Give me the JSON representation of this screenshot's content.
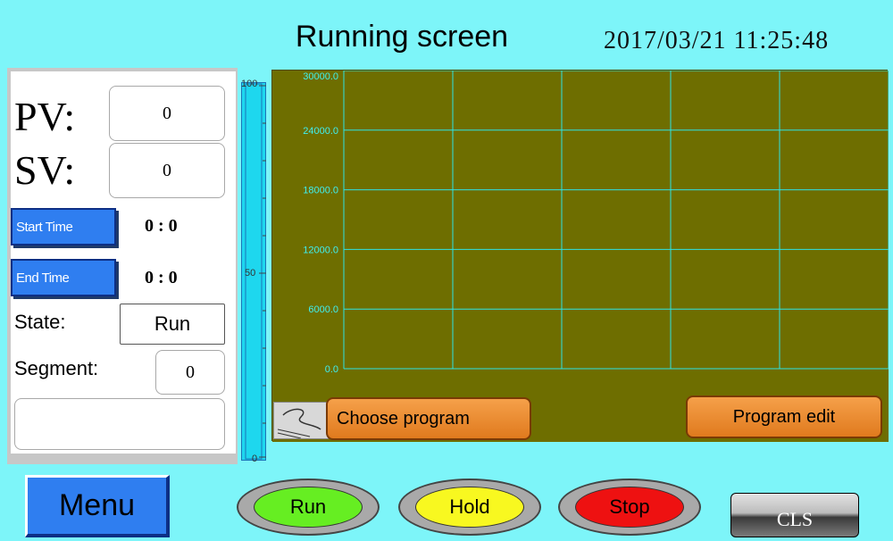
{
  "header": {
    "title": "Running screen",
    "datetime": "2017/03/21 11:25:48"
  },
  "left": {
    "pv_label": "PV:",
    "pv_value": "0",
    "sv_label": "SV:",
    "sv_value": "0",
    "start_time_label": "Start Time",
    "start_time_value": "0 : 0",
    "end_time_label": "End Time",
    "end_time_value": "0 : 0",
    "state_label": "State:",
    "state_value": "Run",
    "segment_label": "Segment:",
    "segment_value": "0",
    "message_value": ""
  },
  "gauge": {
    "ticks": [
      "100",
      "50",
      "0"
    ],
    "level": 0
  },
  "chart_data": {
    "type": "line",
    "y_ticks": [
      "30000.0",
      "24000.0",
      "18000.0",
      "12000.0",
      "6000.0",
      "0.0"
    ],
    "ylim": [
      0,
      30000
    ],
    "grid": true,
    "series": [],
    "colors": {
      "background": "#6e6e00",
      "grid": "#2fe3e3",
      "tick_text": "#3ff0f0"
    }
  },
  "chart_buttons": {
    "choose_program": "Choose program",
    "program_edit": "Program edit"
  },
  "bottom": {
    "menu": "Menu",
    "run": "Run",
    "hold": "Hold",
    "stop": "Stop",
    "cls": "CLS"
  },
  "colors": {
    "background": "#7df5f9",
    "run": "#66ee22",
    "hold": "#f8f820",
    "stop": "#ee1111"
  }
}
